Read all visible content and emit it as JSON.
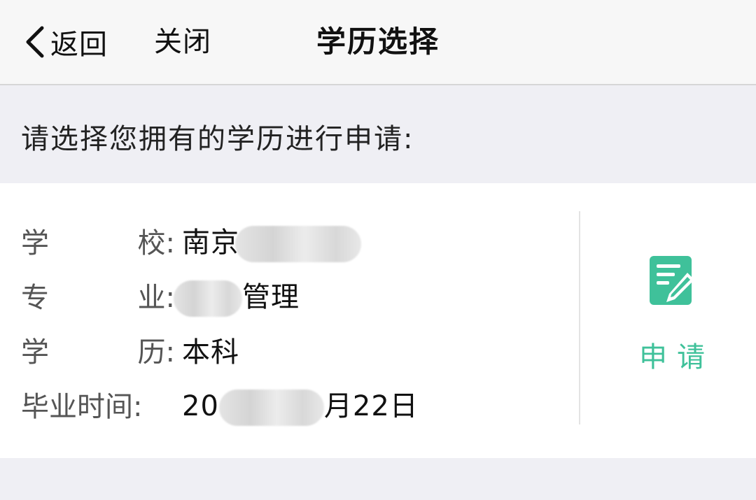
{
  "nav": {
    "back_label": "返回",
    "close_label": "关闭",
    "title": "学历选择"
  },
  "prompt": "请选择您拥有的学历进行申请:",
  "record": {
    "school": {
      "label_a": "学",
      "label_b": "校",
      "colon": ":",
      "value_visible": "南京"
    },
    "major": {
      "label_a": "专",
      "label_b": "业",
      "colon": ":",
      "value_visible": "管理"
    },
    "degree": {
      "label_a": "学",
      "label_b": "历",
      "colon": ":",
      "value_visible": "本科"
    },
    "graduation": {
      "label": "毕业时间",
      "colon": ":",
      "value_prefix": "20",
      "value_suffix": "月22日"
    }
  },
  "apply": {
    "label": "申请",
    "icon": "edit-document-icon",
    "color": "#3fc19a"
  }
}
